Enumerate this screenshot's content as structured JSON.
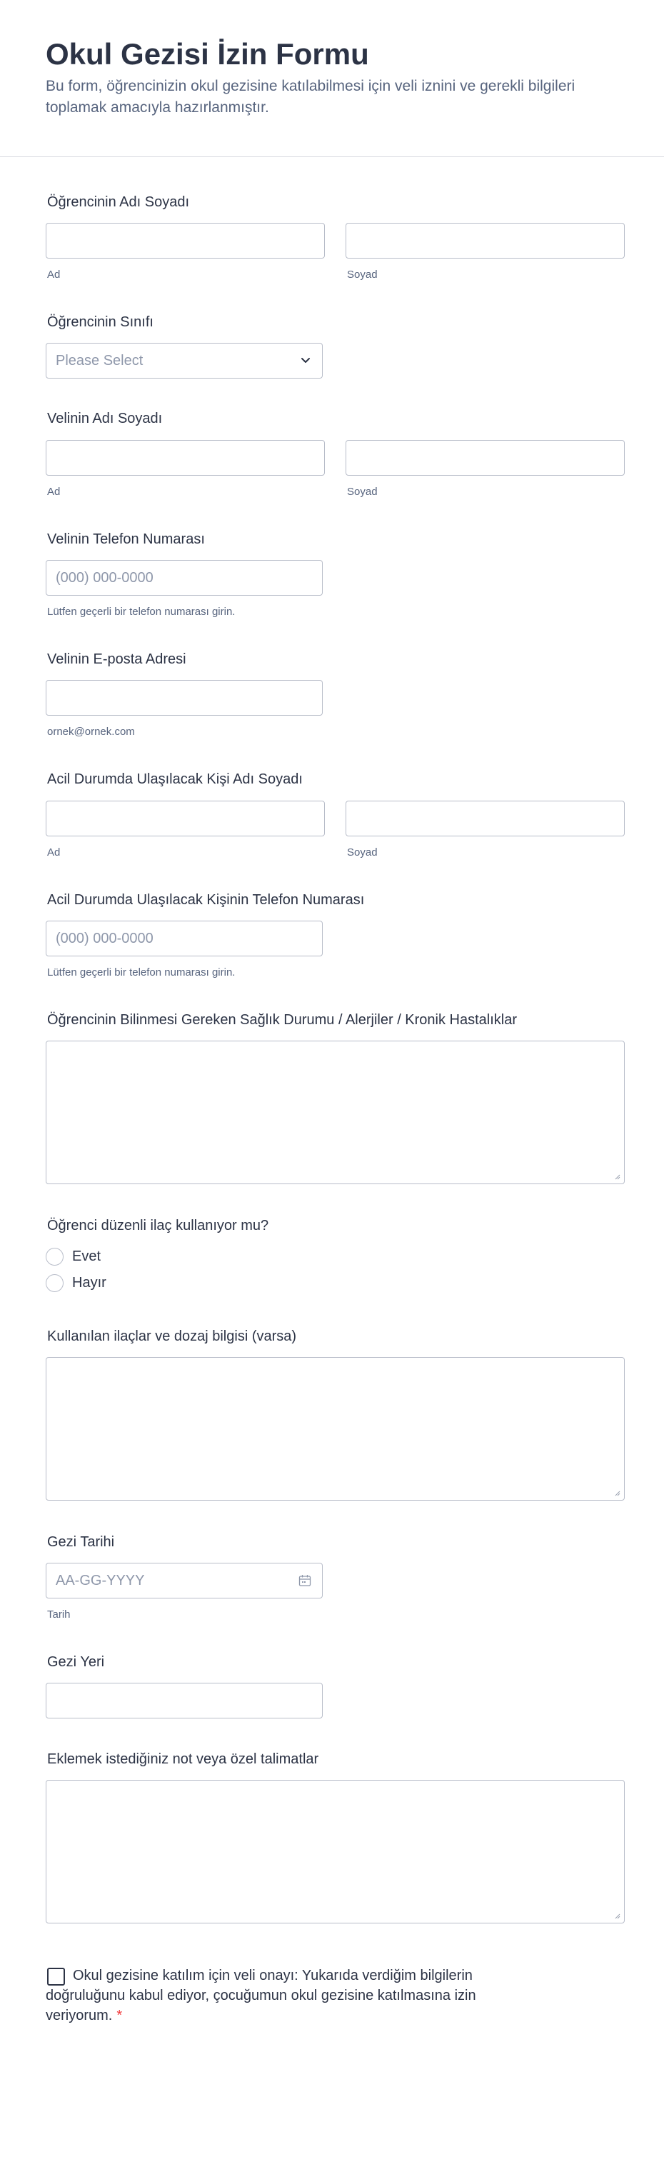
{
  "form": {
    "title": "Okul Gezisi İzin Formu",
    "description": "Bu form, öğrencinizin okul gezisine katılabilmesi için veli iznini ve gerekli bilgileri toplamak amacıyla hazırlanmıştır."
  },
  "student_name": {
    "label": "Öğrencinin Adı Soyadı",
    "first_sublabel": "Ad",
    "last_sublabel": "Soyad"
  },
  "student_class": {
    "label": "Öğrencinin Sınıfı",
    "placeholder": "Please Select"
  },
  "parent_name": {
    "label": "Velinin Adı Soyadı",
    "first_sublabel": "Ad",
    "last_sublabel": "Soyad"
  },
  "parent_phone": {
    "label": "Velinin Telefon Numarası",
    "placeholder": "(000) 000-0000",
    "sublabel": "Lütfen geçerli bir telefon numarası girin."
  },
  "parent_email": {
    "label": "Velinin E-posta Adresi",
    "sublabel": "ornek@ornek.com"
  },
  "emergency_name": {
    "label": "Acil Durumda Ulaşılacak Kişi Adı Soyadı",
    "first_sublabel": "Ad",
    "last_sublabel": "Soyad"
  },
  "emergency_phone": {
    "label": "Acil Durumda Ulaşılacak Kişinin Telefon Numarası",
    "placeholder": "(000) 000-0000",
    "sublabel": "Lütfen geçerli bir telefon numarası girin."
  },
  "health": {
    "label": "Öğrencinin Bilinmesi Gereken Sağlık Durumu / Alerjiler / Kronik Hastalıklar"
  },
  "medication": {
    "label": "Öğrenci düzenli ilaç kullanıyor mu?",
    "options": [
      "Evet",
      "Hayır"
    ]
  },
  "medication_details": {
    "label": "Kullanılan ilaçlar ve dozaj bilgisi (varsa)"
  },
  "trip_date": {
    "label": "Gezi Tarihi",
    "placeholder": "AA-GG-YYYY",
    "sublabel": "Tarih"
  },
  "trip_place": {
    "label": "Gezi Yeri"
  },
  "notes": {
    "label": "Eklemek istediğiniz not veya özel talimatlar"
  },
  "consent": {
    "text": "Okul gezisine katılım için veli onayı: Yukarıda verdiğim bilgilerin doğruluğunu kabul ediyor, çocuğumun okul gezisine katılmasına izin veriyorum.",
    "required_mark": "*"
  },
  "colors": {
    "text": "#2c3345",
    "muted": "#57647e",
    "border": "#b8bdc9",
    "required": "#f23a3c"
  },
  "icons": {
    "select": "chevron-down-icon",
    "date": "calendar-icon",
    "textarea": "resize-handle-icon"
  }
}
